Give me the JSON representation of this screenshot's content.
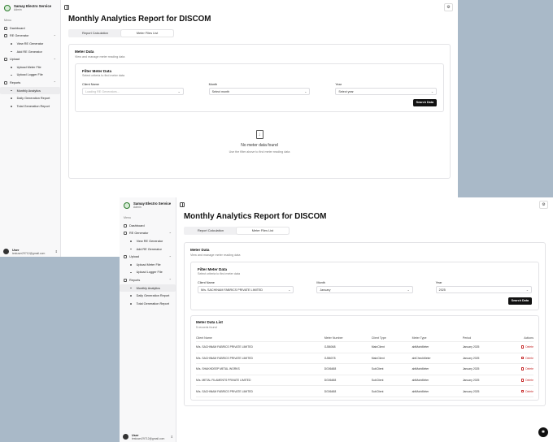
{
  "app": {
    "brand_name": "Samay Electro Service",
    "brand_role": "Admin",
    "menu_label": "Menu",
    "user_name": "User",
    "user_email": "testuser29712@gmail.com"
  },
  "nav": {
    "dashboard": "Dashboard",
    "re_generator": "RE Generator",
    "view_re_generator": "View RE Generator",
    "add_re_generator": "Add RE Generator",
    "upload": "Upload",
    "upload_meter_file": "Upload Meter File",
    "upload_logger_file": "Upload Logger File",
    "reports": "Reports",
    "monthly_analytics": "Monthly Analytics",
    "daily_generation_report": "Daily Generation Report",
    "total_generation_report": "Total Generation Report"
  },
  "page": {
    "title": "Monthly Analytics Report for DISCOM",
    "tab_report": "Report Calculation",
    "tab_meter": "Meter Files List"
  },
  "meter_card": {
    "title": "Meter Data",
    "desc": "View and manage meter reading data"
  },
  "filter": {
    "title": "Filter Meter Data",
    "desc": "Select criteria to find meter data",
    "client_label": "Client Name",
    "month_label": "Month",
    "year_label": "Year",
    "search_label": "Search Data"
  },
  "window1": {
    "client_value": "Loading RE Generators...",
    "month_value": "Select month",
    "year_value": "Select year",
    "empty_title": "No meter data found",
    "empty_desc": "Use the filter above to find meter reading data"
  },
  "window2": {
    "client_value": "M/s. SACHINAM FABRICS PRIVATE LIMITED",
    "month_value": "January",
    "year_value": "2025",
    "list_title": "Meter Data List",
    "list_count": "5 records found",
    "headers": [
      "Client Name",
      "Meter Number",
      "Client Type",
      "Meter Type",
      "Period",
      "Actions"
    ],
    "delete_label": "Delete",
    "rows": [
      [
        "M/s. SACHINAM FABRICS PRIVATE LIMITED",
        "GJ86068",
        "MainClient",
        "abtMainMeter",
        "January 2025"
      ],
      [
        "M/s. SACHINAM FABRICS PRIVATE LIMITED",
        "GJ86078",
        "MainClient",
        "abtCheckMeter",
        "January 2025"
      ],
      [
        "M/s. SHAKHDEEP METAL WORKS",
        "DG06488",
        "SubClient",
        "abtMainMeter",
        "January 2025"
      ],
      [
        "M/s. METAL FILAMENTS PRIVATE LIMITED",
        "DG06488",
        "SubClient",
        "abtMainMeter",
        "January 2025"
      ],
      [
        "M/s. SACHINAM FABRICS PRIVATE LIMITED",
        "DG06488",
        "SubClient",
        "abtMainMeter",
        "January 2025"
      ]
    ]
  },
  "icons": {
    "settings": "gear-icon",
    "sidebar_toggle": "sidebar-toggle-icon",
    "empty_state": "file-download-icon",
    "delete": "trash-icon"
  }
}
